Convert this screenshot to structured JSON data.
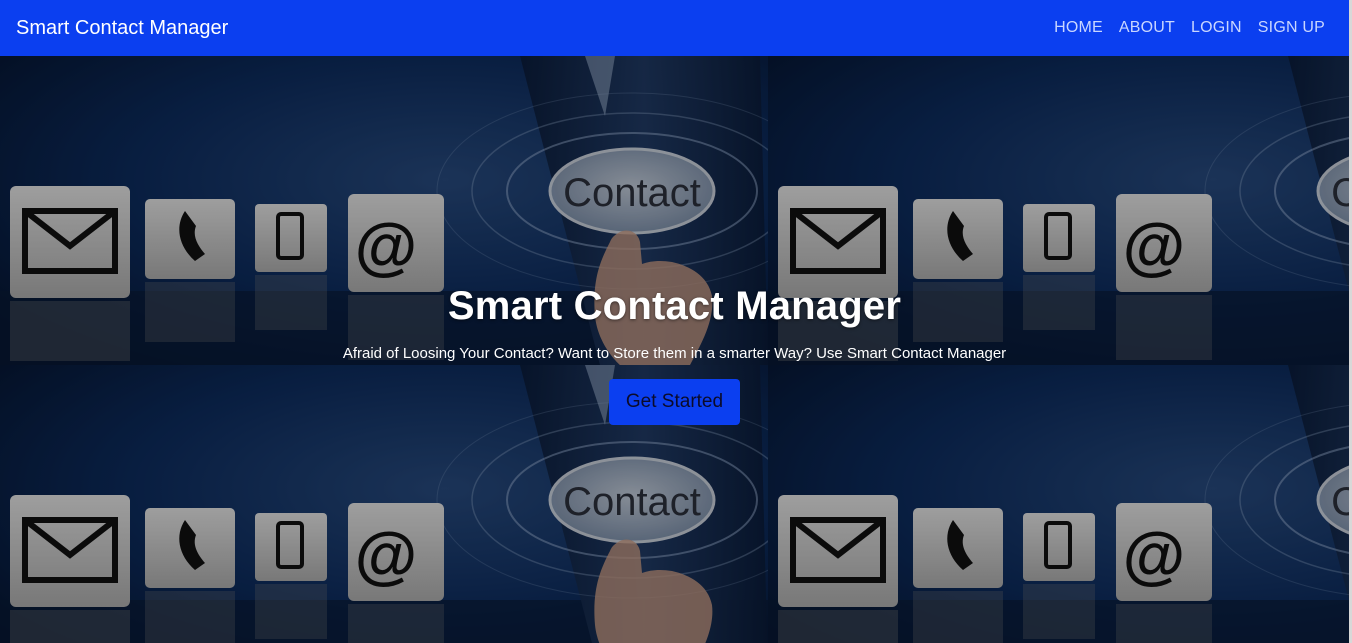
{
  "navbar": {
    "brand": "Smart Contact Manager",
    "links": [
      "HOME",
      "ABOUT",
      "LOGIN",
      "SIGN UP"
    ]
  },
  "hero": {
    "title": "Smart Contact Manager",
    "subtitle": "Afraid of Loosing Your Contact? Want to Store them in a smarter Way? Use Smart Contact Manager",
    "cta_label": "Get Started",
    "background_word": "Contact",
    "background_icons": [
      "envelope-icon",
      "phone-icon",
      "mobile-phone-icon",
      "at-sign-icon"
    ]
  },
  "colors": {
    "navbar": "#0b3ff0",
    "button": "#0b3ff0",
    "background_dark": "#0a1a33"
  }
}
